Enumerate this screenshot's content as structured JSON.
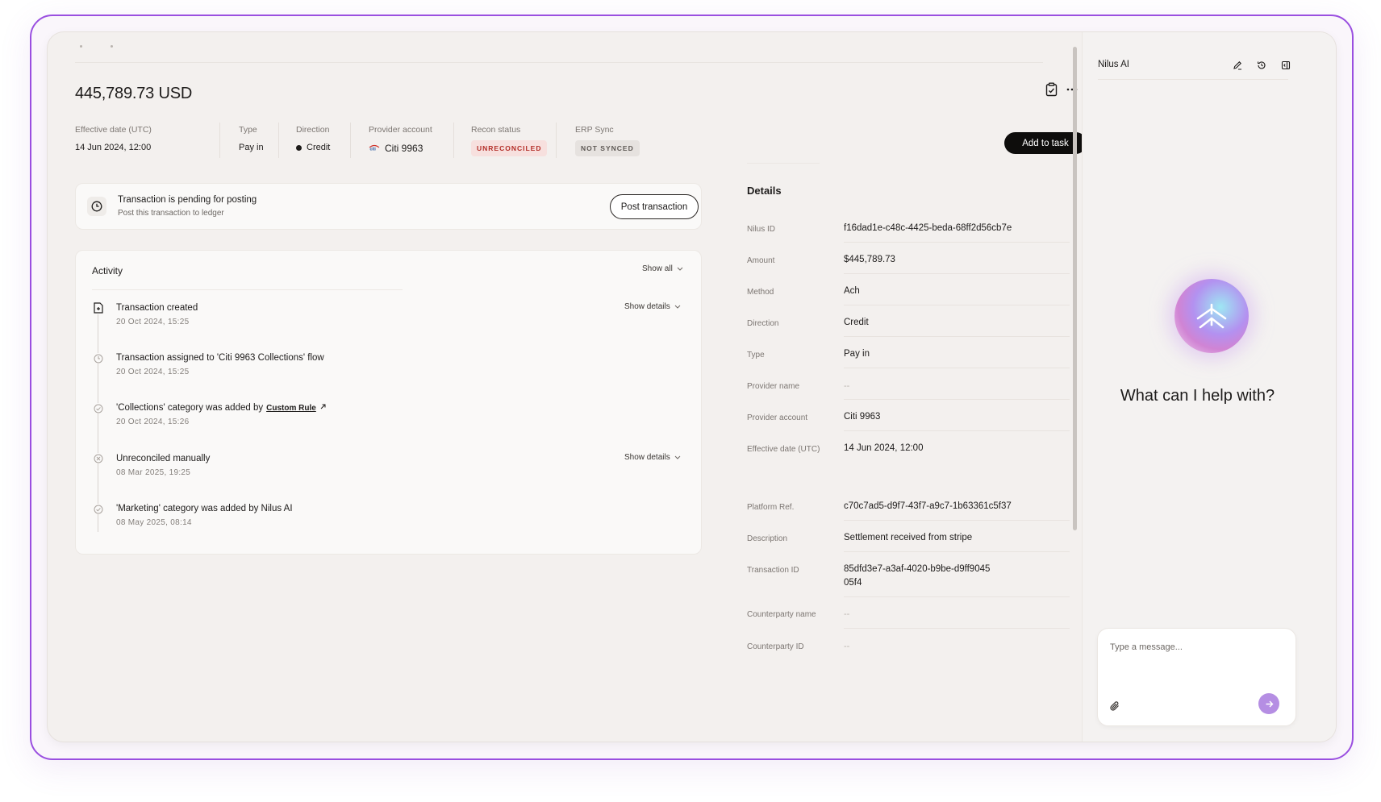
{
  "transaction": {
    "amount_title": "445,789.73 USD"
  },
  "meta": {
    "effective_date": {
      "label": "Effective date (UTC)",
      "value": "14 Jun 2024, 12:00"
    },
    "type": {
      "label": "Type",
      "value": "Pay in"
    },
    "direction": {
      "label": "Direction",
      "value": "Credit"
    },
    "provider_account": {
      "label": "Provider account",
      "value": "Citi 9963",
      "logo": "citi"
    },
    "recon_status": {
      "label": "Recon status",
      "value": "UNRECONCILED",
      "color": "#b32d27"
    },
    "erp_sync": {
      "label": "ERP Sync",
      "value": "NOT SYNCED"
    }
  },
  "actions": {
    "add_to_task": "Add to task",
    "more_icon": "more-horizontal-icon",
    "clipboard_icon": "clipboard-icon"
  },
  "pending": {
    "title": "Transaction is pending for posting",
    "subtitle": "Post this transaction to ledger",
    "button": "Post transaction"
  },
  "activity": {
    "title": "Activity",
    "show_all": "Show all",
    "events": [
      {
        "title": "Transaction created",
        "time": "20 Oct 2024, 15:25",
        "show_details": "Show details",
        "icon": "file-plus-icon"
      },
      {
        "title": "Transaction assigned to 'Citi 9963 Collections' flow",
        "time": "20 Oct 2024, 15:25",
        "icon": "clock-icon"
      },
      {
        "title_prefix": "'Collections' category was added by",
        "link": "Custom Rule",
        "time": "20 Oct 2024, 15:26",
        "icon": "check-circle-icon"
      },
      {
        "title": "Unreconciled manually",
        "time": "08 Mar 2025, 19:25",
        "show_details": "Show details",
        "icon": "x-circle-icon"
      },
      {
        "title": "'Marketing' category was added by Nilus AI",
        "time": "08 May 2025, 08:14",
        "icon": "check-circle-icon"
      }
    ]
  },
  "details": {
    "title": "Details",
    "rows": [
      {
        "label": "Nilus ID",
        "value": "f16dad1e-c48c-4425-beda-68ff2d56cb7e"
      },
      {
        "label": "Amount",
        "value": "$445,789.73"
      },
      {
        "label": "Method",
        "value": "Ach"
      },
      {
        "label": "Direction",
        "value": "Credit"
      },
      {
        "label": "Type",
        "value": "Pay in"
      },
      {
        "label": "Provider name",
        "value": "--"
      },
      {
        "label": "Provider account",
        "value": "Citi 9963"
      },
      {
        "label": "Effective date (UTC)",
        "value": "14 Jun 2024, 12:00"
      },
      {
        "label": "Platform Ref.",
        "value": "c70c7ad5-d9f7-43f7-a9c7-1b63361c5f37"
      },
      {
        "label": "Description",
        "value": "Settlement received from stripe"
      },
      {
        "label": "Transaction ID",
        "value": "85dfd3e7-a3af-4020-b9be-d9ff9045",
        "value_line2": "05f4"
      },
      {
        "label": "Counterparty name",
        "value": "--"
      },
      {
        "label": "Counterparty ID",
        "value": "--"
      }
    ]
  },
  "chat": {
    "title": "Nilus AI",
    "prompt": "What can I help with?",
    "input_placeholder": "Type a message...",
    "icons": [
      "edit-icon",
      "history-icon",
      "panel-toggle-icon"
    ]
  }
}
